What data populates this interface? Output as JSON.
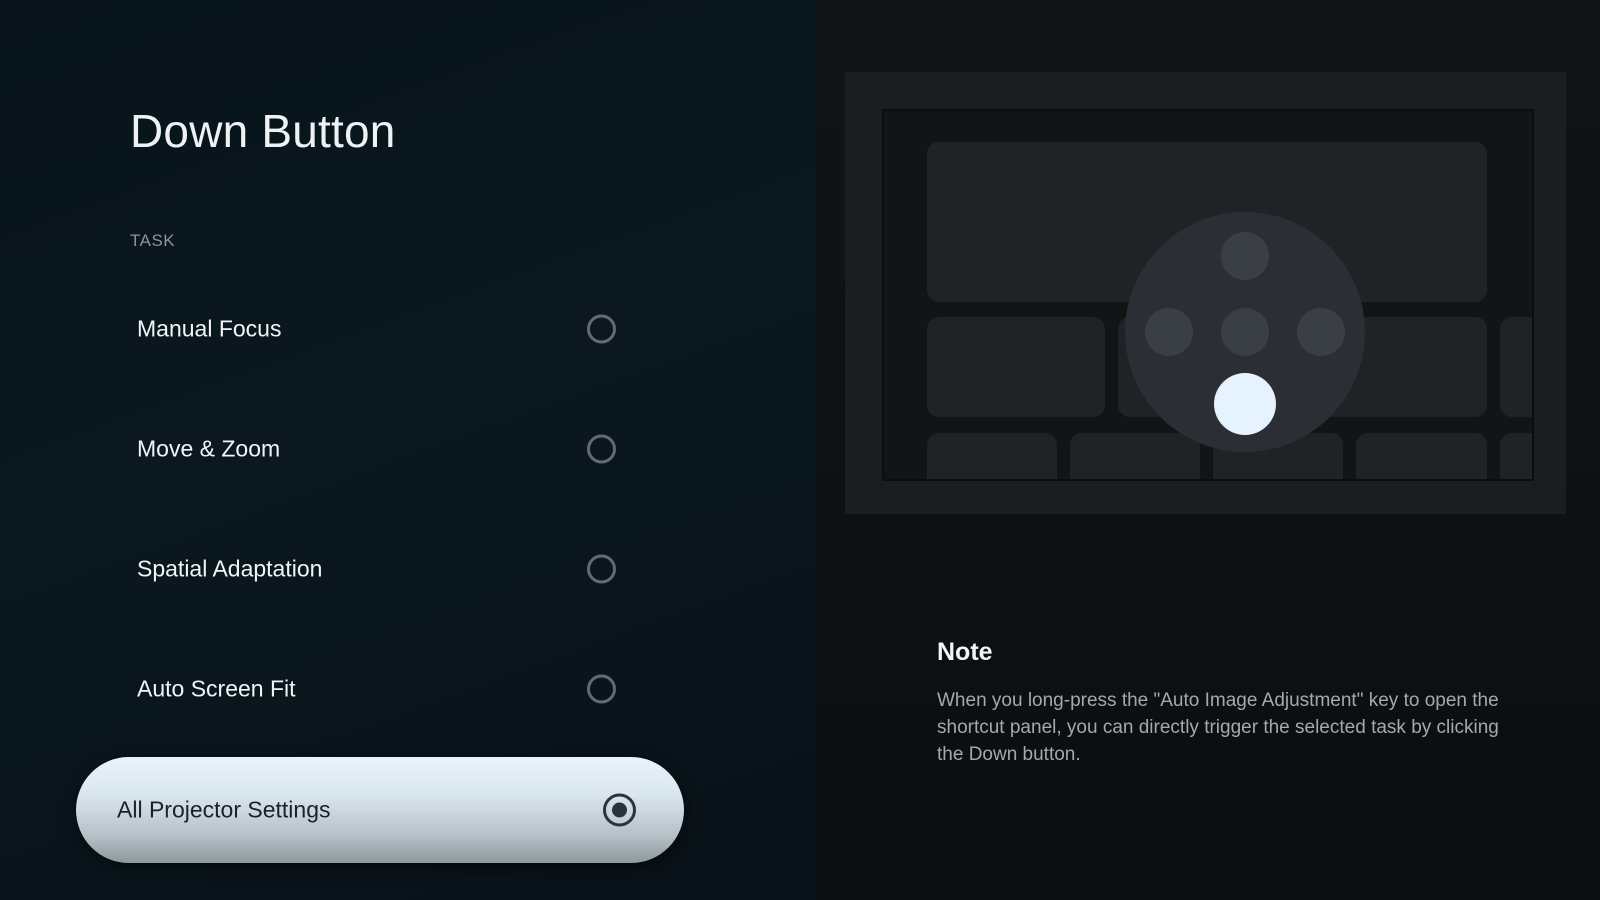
{
  "page": {
    "title": "Down Button"
  },
  "task_section": {
    "label": "TASK",
    "options": [
      {
        "label": "Manual Focus",
        "selected": false
      },
      {
        "label": "Move & Zoom",
        "selected": false
      },
      {
        "label": "Spatial Adaptation",
        "selected": false
      },
      {
        "label": "Auto Screen Fit",
        "selected": false
      },
      {
        "label": "All Projector Settings",
        "selected": true
      }
    ]
  },
  "note": {
    "title": "Note",
    "body": "When you long-press the \"Auto Image Adjustment\" key to open the shortcut panel, you can directly trigger the selected task by clicking the Down button."
  },
  "illustration": {
    "highlighted_button": "down",
    "colors": {
      "highlight": "#e6f3ff",
      "remote_pad": "#2b2e35"
    }
  },
  "colors": {
    "selected_pill": "#dbe7f0",
    "background": "#0b1820",
    "text_primary": "#f2f5f7",
    "text_secondary": "#a3a9ae"
  }
}
